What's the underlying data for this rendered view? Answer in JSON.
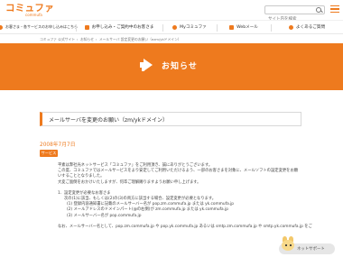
{
  "header": {
    "logo_main": "コミュファ",
    "logo_sub": "commufa",
    "search_placeholder": "サイト内を検索"
  },
  "nav": [
    {
      "label": "お客さま・各サービスのお申し込みはこちら",
      "icon": "person-icon"
    },
    {
      "label": "お申し込み・ご契約中のお客さま",
      "icon": "document-icon"
    },
    {
      "label": "Myコミュファ",
      "icon": "heart-icon"
    },
    {
      "label": "Webメール",
      "icon": "mail-icon"
    },
    {
      "label": "よくあるご質問",
      "icon": "question-icon"
    }
  ],
  "breadcrumb": [
    "コミュファ 公式サイト",
    "お知らせ",
    "メールサーバ 設定変更のお願い（ezm/ykドメイン）"
  ],
  "banner": {
    "title": "お知らせ",
    "icon": "megaphone-icon"
  },
  "article": {
    "title": "メールサーバを変更のお願い（zm/ykドメイン）",
    "date": "2008年7月7日",
    "category": "サービス",
    "lines": [
      "平素は弊社光ネットサービス「コミュファ」をご利用頂き、誠にありがとうございます。",
      "この度、コミュファではメールサービスをより安定してご利用いただけるよう、一部のお客さまを対象に、メールソフトの設定変更をお願",
      "いすることとなりました。",
      "大変ご面倒をおかけいたしますが、何卒ご理解賜りますようお願い申し上げます。",
      "",
      "1．設定変更が必要なお客さま",
      "次の(1)に該当、もしくは(2)の(3)の両方に該当する場合、設定変更が必要となります。",
      "(1) 登録内容通知書に記載のメールサーバー名が pop.zm.commufa.jp または yk.commufa.jp",
      "(2) メールアドレスのドメインパート(@の右側)が zm.commufa.jp または yk.commufa.jp",
      "(3) メールサーバー名が pop.commufa.jp",
      "",
      "なお、メールサーバー名として、pop.zm.commufa.jp や pop.yk.commufa.jp あるいは smtp.zm.commufa.jp や smtp.yk.commufa.jp をご"
    ]
  },
  "chat": {
    "label": "ネットサポート",
    "icon": "support-character-icon"
  },
  "colors": {
    "accent": "#ee7a1e",
    "text": "#333333"
  }
}
